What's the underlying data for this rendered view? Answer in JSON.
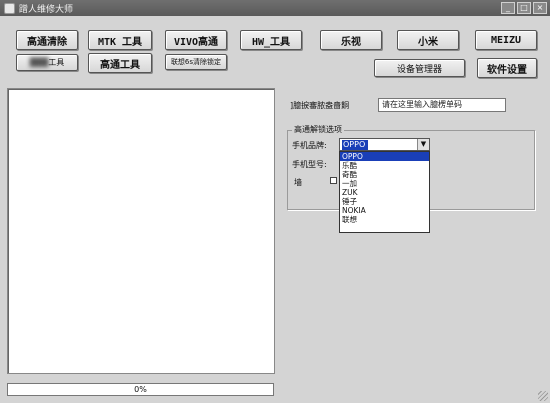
{
  "window": {
    "title": "蹭人维修大师",
    "minimize": "_",
    "maximize": "□",
    "close": "×"
  },
  "toolbar": {
    "row1": [
      "高通清除",
      "MTK 工具",
      "VIVO高通",
      "HW_工具",
      "乐视",
      "小米",
      "MEIZU"
    ],
    "row2": {
      "blurred": "工具",
      "qualcomm_tools": "高通工具",
      "lenovo_clear": "联想6s清除锁定",
      "device_manager": "设备管理器",
      "software_settings": "软件设置"
    }
  },
  "progress": {
    "text": "0%",
    "value": 0
  },
  "unlock": {
    "label": "]臆捩審脓盎嗇餇",
    "input_value": "请在这里输入臆楞单码"
  },
  "qualcomm_options": {
    "title": "高通解锁选项",
    "brand_label": "手机品牌:",
    "brand_value": "OPPO",
    "model_label": "手机型号:",
    "extra_label": "墙",
    "brand_options": [
      "OPPO",
      "乐酷",
      "奇酷",
      "一加",
      "ZUK",
      "锤子",
      "NOKIA",
      "联想"
    ]
  }
}
